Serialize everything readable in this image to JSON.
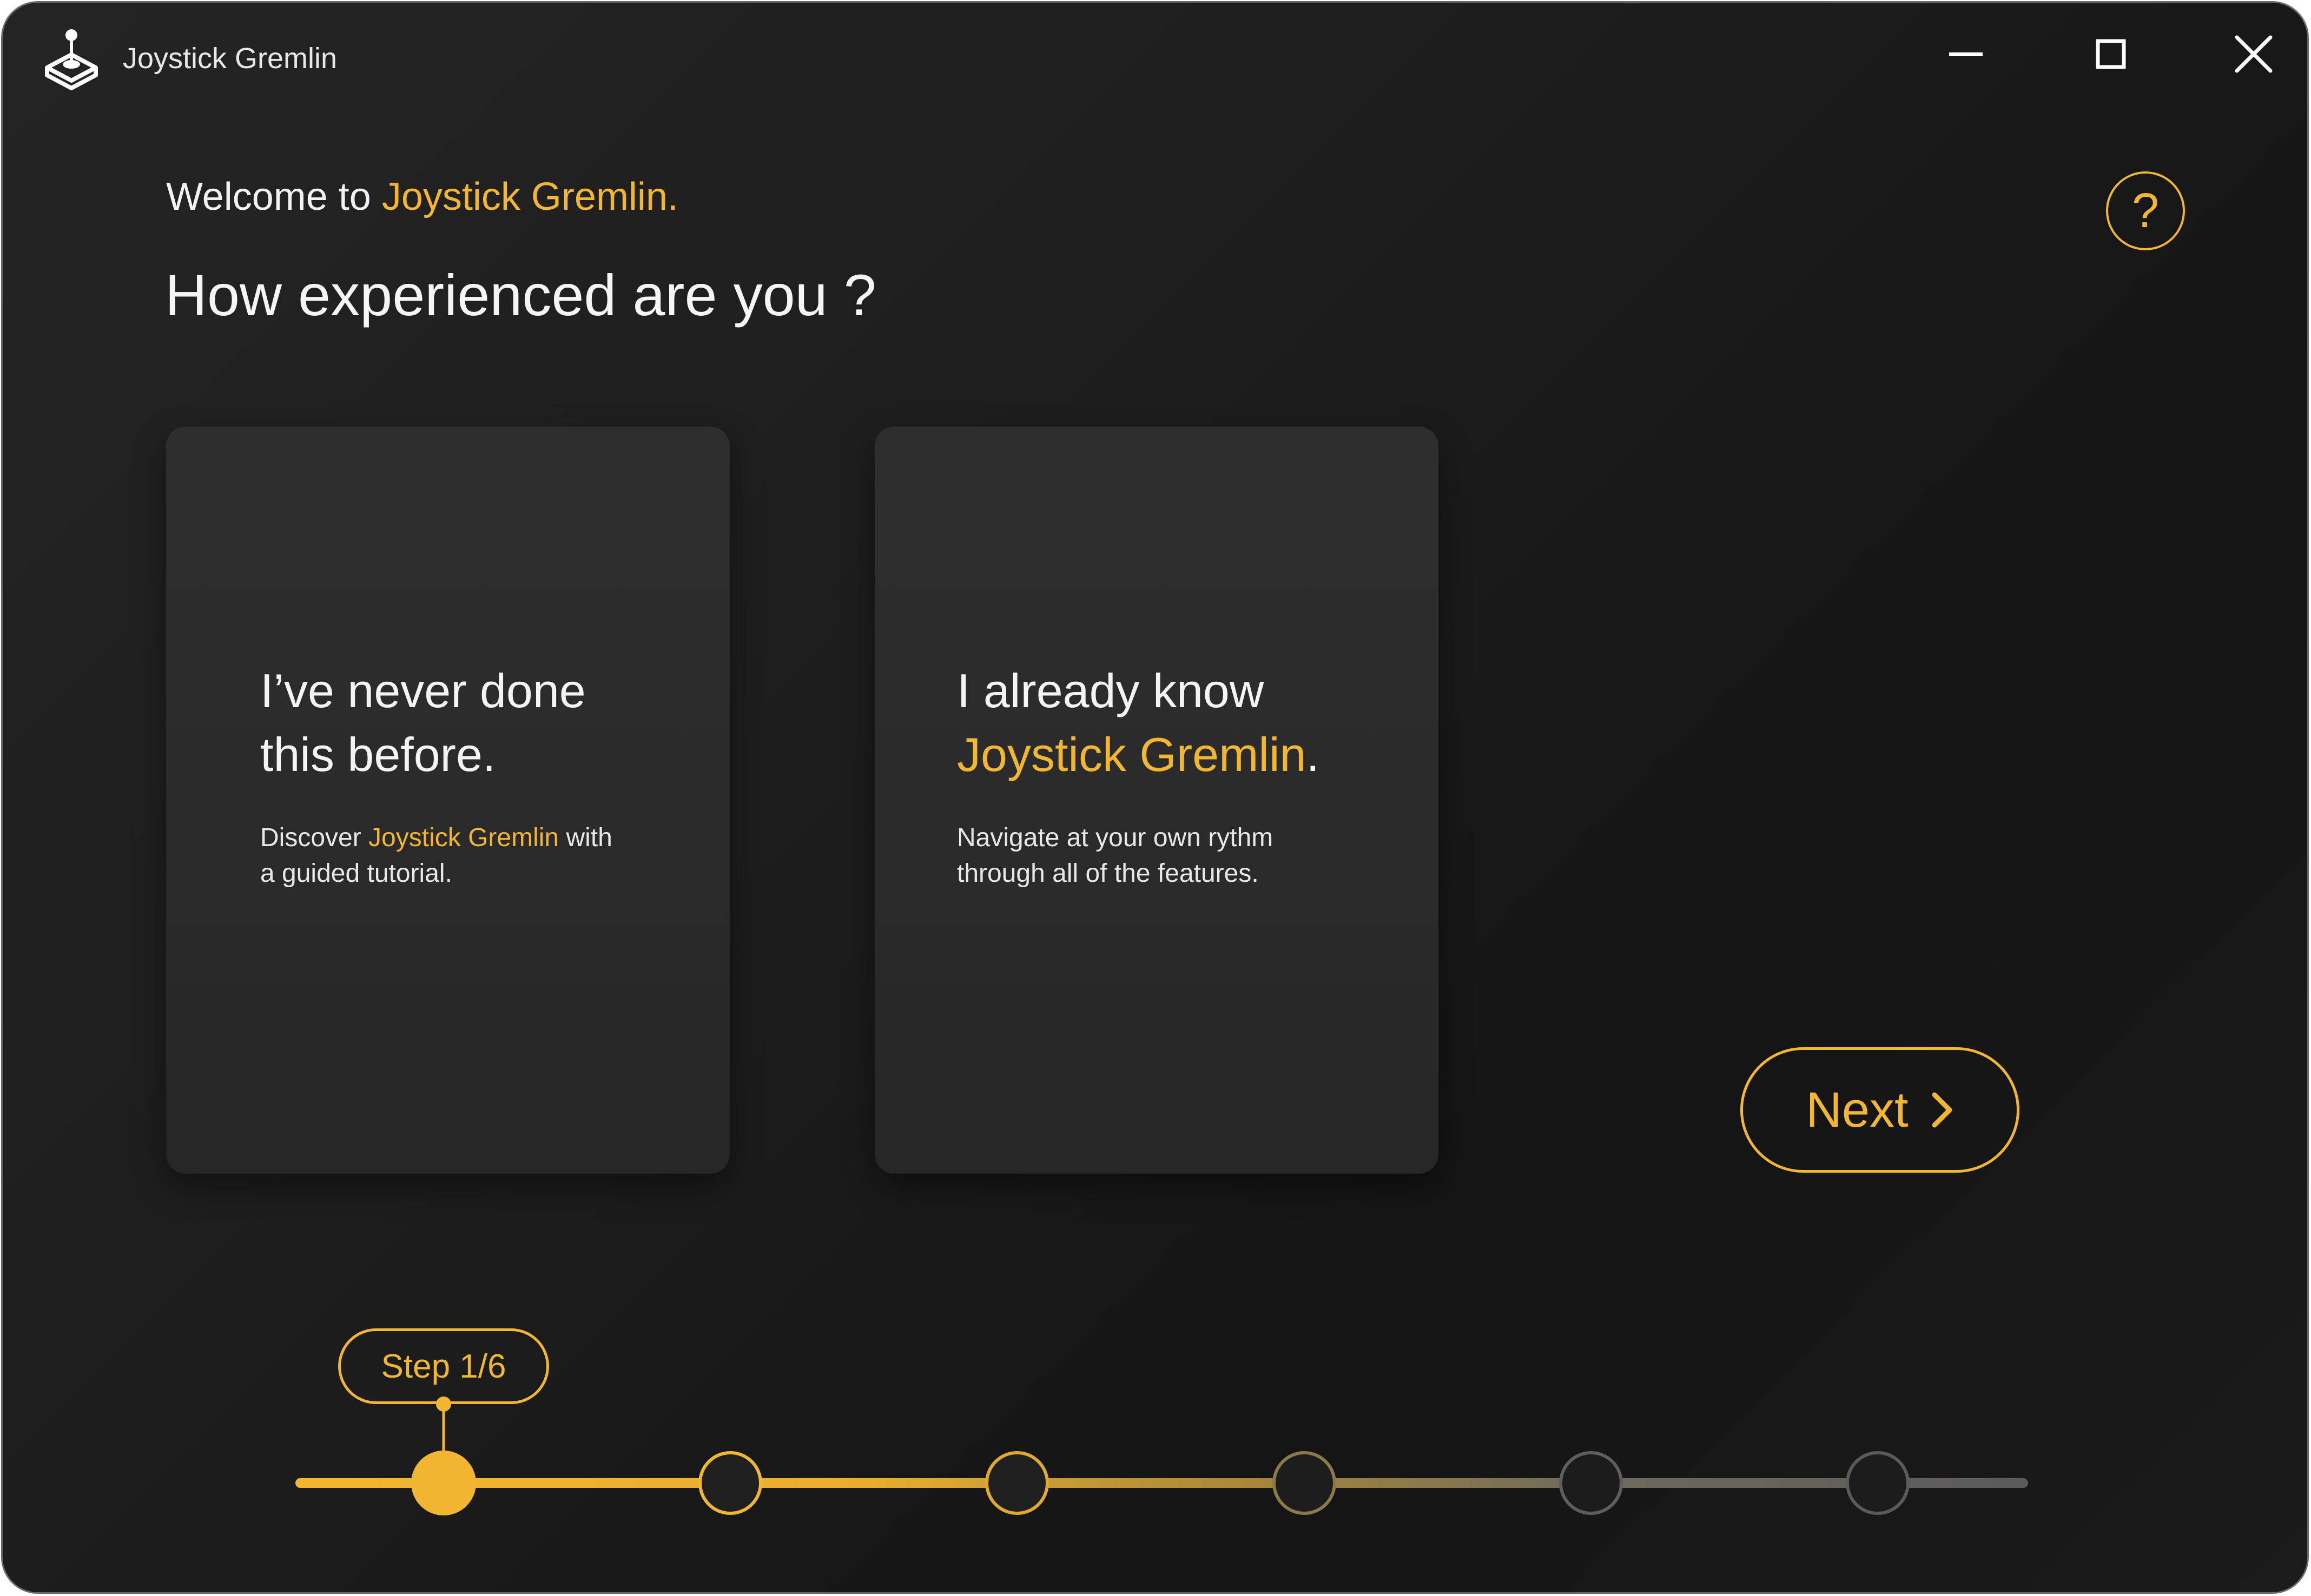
{
  "window": {
    "title": "Joystick Gremlin",
    "icon": "joystick-icon",
    "controls": {
      "minimize_icon": "minimize-icon",
      "maximize_icon": "maximize-icon",
      "close_icon": "close-icon"
    }
  },
  "header": {
    "welcome_prefix": "Welcome to ",
    "welcome_app": "Joystick Gremlin.",
    "question": "How experienced are you ?",
    "help_label": "?"
  },
  "cards": [
    {
      "title_line1": "I’ve never done",
      "title_line2": "this before.",
      "desc_prefix": "Discover ",
      "desc_app": "Joystick Gremlin",
      "desc_mid": " with",
      "desc_line2": "a guided tutorial."
    },
    {
      "title_line1": "I already know",
      "title_app": "Joystick Gremlin",
      "title_suffix": ".",
      "desc_line1": "Navigate at your own rythm",
      "desc_line2": "through all of the features."
    }
  ],
  "navigation": {
    "next_label": "Next",
    "next_icon": "chevron-right-icon"
  },
  "progress": {
    "step_label": "Step 1/6",
    "current_step": 1,
    "total_steps": 6
  },
  "colors": {
    "accent": "#f2b630",
    "background": "#1c1c1c",
    "card": "#2c2c2c",
    "inactive_track": "#5a5a5a"
  }
}
